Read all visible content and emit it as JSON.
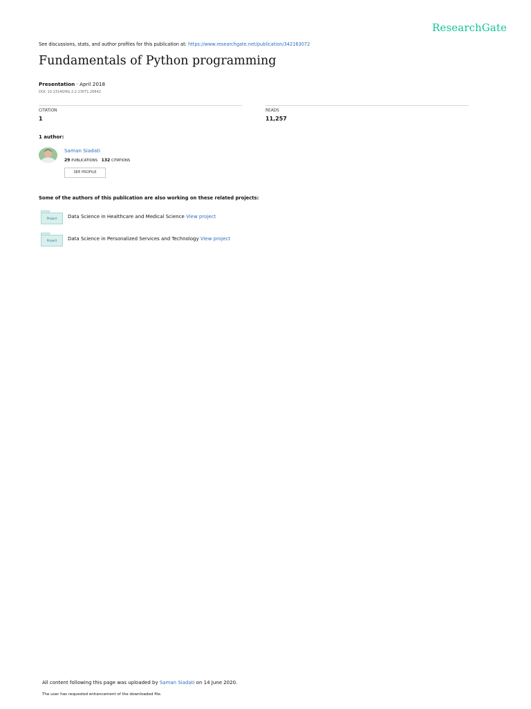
{
  "brand": {
    "logo_text": "ResearchGate",
    "accent_color": "#15c39a",
    "link_color": "#2d6cc0"
  },
  "header": {
    "discussion_text": "See discussions, stats, and author profiles for this publication at: ",
    "publication_url": "https://www.researchgate.net/publication/342163072"
  },
  "publication": {
    "title": "Fundamentals of Python programming",
    "type": "Presentation",
    "date_sep": " · ",
    "date": "April 2018",
    "doi": "DOI: 10.13140/RG.2.2.13071.20642"
  },
  "stats": {
    "citation_label": "CITATION",
    "citation_value": "1",
    "reads_label": "READS",
    "reads_value": "11,257"
  },
  "authors": {
    "label": "1 author:",
    "items": [
      {
        "name": "Saman Siadati",
        "publications_count": "29",
        "publications_label": "PUBLICATIONS",
        "citations_count": "132",
        "citations_label": "CITATIONS",
        "profile_button": "SEE PROFILE"
      }
    ]
  },
  "related": {
    "label": "Some of the authors of this publication are also working on these related projects:",
    "folder_label": "Project",
    "projects": [
      {
        "name": "Data Science in Healthcare and Medical Science",
        "link_text": "View project"
      },
      {
        "name": "Data Science in Personalized Services and Technology",
        "link_text": "View project"
      }
    ]
  },
  "footer": {
    "upload_prefix": "All content following this page was uploaded by ",
    "uploader": "Saman Siadati",
    "upload_suffix": " on 14 June 2020.",
    "enhancement_note": "The user has requested enhancement of the downloaded file."
  }
}
